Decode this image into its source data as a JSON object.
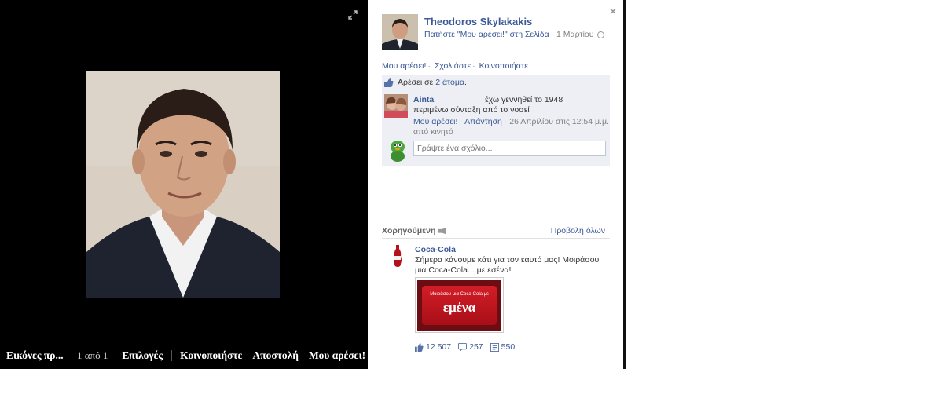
{
  "stage": {
    "album_title": "Εικόνες πρ...",
    "counter": "1 από 1",
    "actions": [
      "Επιλογές",
      "Κοινοποιήστε",
      "Αποστολή",
      "Μου αρέσει!"
    ]
  },
  "panel": {
    "owner_name": "Theodoros Skylakakis",
    "owner_sub": "Πατήστε \"Μου αρέσει!\" στη Σελίδα",
    "date": "· 1 Μαρτίου",
    "close": "×",
    "actions": [
      "Μου αρέσει!",
      "Σχολιάστε",
      "Κοινοποιήστε"
    ]
  },
  "likes": {
    "prefix": "Αρέσει σε",
    "count": "2 άτομα",
    "suffix": "."
  },
  "comment": {
    "author": "Ainta",
    "text_line1": "έχω γεννηθεί το 1948",
    "text_line2": "περιμένω σύνταξη από το νοσεί",
    "like": "Μου αρέσει!",
    "reply": "Απάντηση",
    "time": "· 26 Απριλίου στις 12:54 μ.μ.",
    "via": "από κινητό"
  },
  "comment_box": {
    "placeholder": "Γράψτε ένα σχόλιο..."
  },
  "sponsored": {
    "title": "Χορηγούμενη",
    "see_all": "Προβολή όλων"
  },
  "ad": {
    "brand": "Coca-Cola",
    "text": "Σήμερα κάνουμε κάτι για τον εαυτό μας! Μοιράσου μια Coca-Cola... με εσένα!",
    "image_small": "Μοιράσου μια Coca-Cola με",
    "image_big": "εμένα",
    "likes": "12.507",
    "comments": "257",
    "shares": "550"
  },
  "colors": {
    "link": "#3b5998",
    "stage_bg": "#000000",
    "ufi_bg": "#edeff4",
    "coke_red": "#d31d27"
  }
}
